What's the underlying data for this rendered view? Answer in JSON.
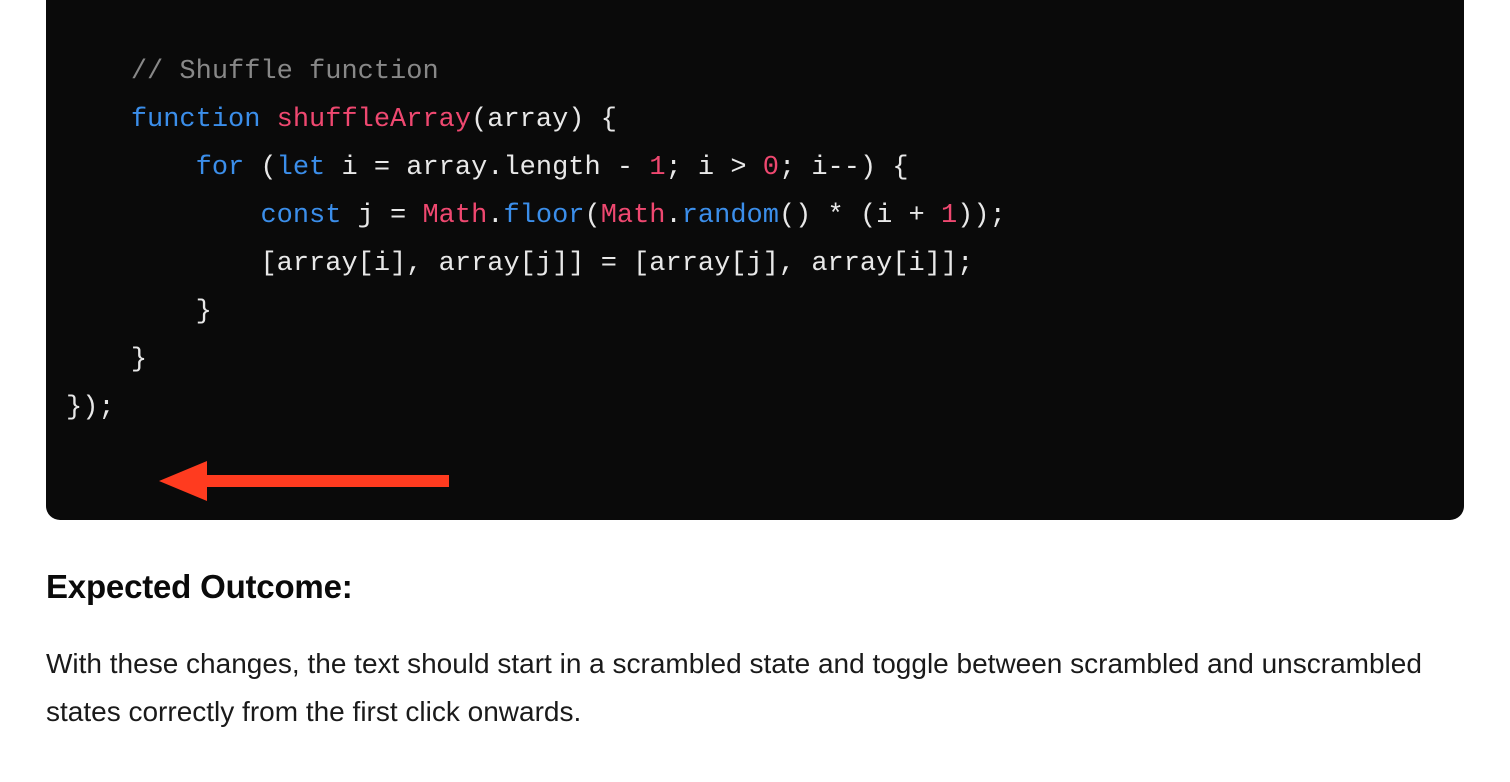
{
  "code": {
    "comment": "// Shuffle function",
    "kw_function": "function",
    "fn_name": "shuffleArray",
    "sig_open": "(array) {",
    "kw_for": "for",
    "for_open": " (",
    "kw_let": "let",
    "for_init": " i = array.length - ",
    "num_1a": "1",
    "for_mid": "; i > ",
    "num_0": "0",
    "for_end": "; i--) {",
    "kw_const": "const",
    "const_j": " j = ",
    "obj_math1": "Math",
    "dot1": ".",
    "m_floor": "floor",
    "paren1": "(",
    "obj_math2": "Math",
    "dot2": ".",
    "m_random": "random",
    "rand_close": "() * (i + ",
    "num_1b": "1",
    "rand_tail": "));",
    "swap_line": "[array[i], array[j]] = [array[j], array[i]];",
    "brace_inner": "}",
    "brace_fn": "}",
    "close_outer": "});"
  },
  "heading": "Expected Outcome:",
  "paragraph": "With these changes, the text should start in a scrambled state and toggle between scrambled and unscrambled states correctly from the first click onwards."
}
